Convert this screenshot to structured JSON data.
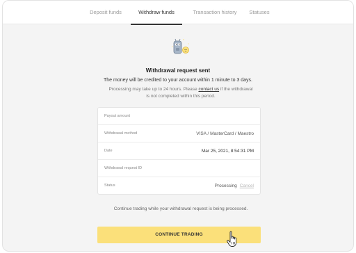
{
  "tabs": [
    {
      "label": "Deposit funds",
      "active": false
    },
    {
      "label": "Withdraw funds",
      "active": true
    },
    {
      "label": "Transaction history",
      "active": false
    },
    {
      "label": "Statuses",
      "active": false
    }
  ],
  "header": {
    "title": "Withdrawal request sent",
    "subtitle": "The money will be credited to your account within 1 minute to 3 days.",
    "note_before": "Processing may take up to 24 hours. Please ",
    "note_link": "contact us",
    "note_after": " if the withdrawal is not completed within this period."
  },
  "details": {
    "rows": [
      {
        "label": "Payout amount",
        "value": ""
      },
      {
        "label": "Withdrawal method",
        "value": "VISA / MasterCard / Maestro"
      },
      {
        "label": "Date",
        "value": "Mar 25, 2021, 8:54:31 PM"
      },
      {
        "label": "Withdrawal request ID",
        "value": ""
      },
      {
        "label": "Status",
        "value": "Processing",
        "action": "Cancel"
      }
    ]
  },
  "footer": {
    "note": "Continue trading while your withdrawal request is being processed.",
    "button_label": "CONTINUE TRADING"
  },
  "colors": {
    "accent": "#fbe07a",
    "background": "#f4f4f4"
  },
  "icons": {
    "illustration": "mascot-with-coin-icon",
    "cursor": "hand-pointer-icon"
  }
}
